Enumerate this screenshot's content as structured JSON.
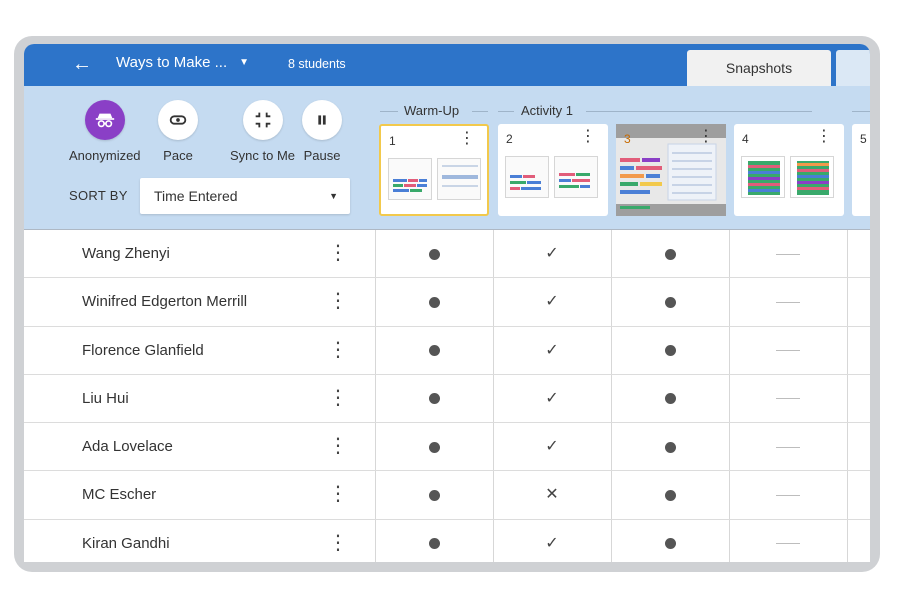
{
  "header": {
    "lesson_title": "Ways to Make ...",
    "student_count": "8 students",
    "tab_snapshots": "Snapshots"
  },
  "controls": {
    "anonymized": "Anonymized",
    "pace": "Pace",
    "sync": "Sync to Me",
    "pause": "Pause",
    "sort_by_label": "SORT BY",
    "sort_value": "Time Entered"
  },
  "groups": {
    "warmup": "Warm-Up",
    "activity": "Activity 1"
  },
  "slides": [
    "1",
    "2",
    "3",
    "4",
    "5"
  ],
  "students": [
    {
      "name": "Wang Zhenyi",
      "status": [
        "dot",
        "check",
        "dot",
        "dash"
      ]
    },
    {
      "name": "Winifred Edgerton Merrill",
      "status": [
        "dot",
        "check",
        "dot",
        "dash"
      ]
    },
    {
      "name": "Florence Glanfield",
      "status": [
        "dot",
        "check",
        "dot",
        "dash"
      ]
    },
    {
      "name": "Liu Hui",
      "status": [
        "dot",
        "check",
        "dot",
        "dash"
      ]
    },
    {
      "name": "Ada Lovelace",
      "status": [
        "dot",
        "check",
        "dot",
        "dash"
      ]
    },
    {
      "name": "MC Escher",
      "status": [
        "dot",
        "cross",
        "dot",
        "dash"
      ]
    },
    {
      "name": "Kiran Gandhi",
      "status": [
        "dot",
        "check",
        "dot",
        "dash"
      ]
    }
  ],
  "colors": {
    "topbar": "#2d74c9",
    "controls_bg": "#c5dbf1",
    "anonymized_active": "#8a3fc6",
    "selected_slide_border": "#f2c94c"
  }
}
